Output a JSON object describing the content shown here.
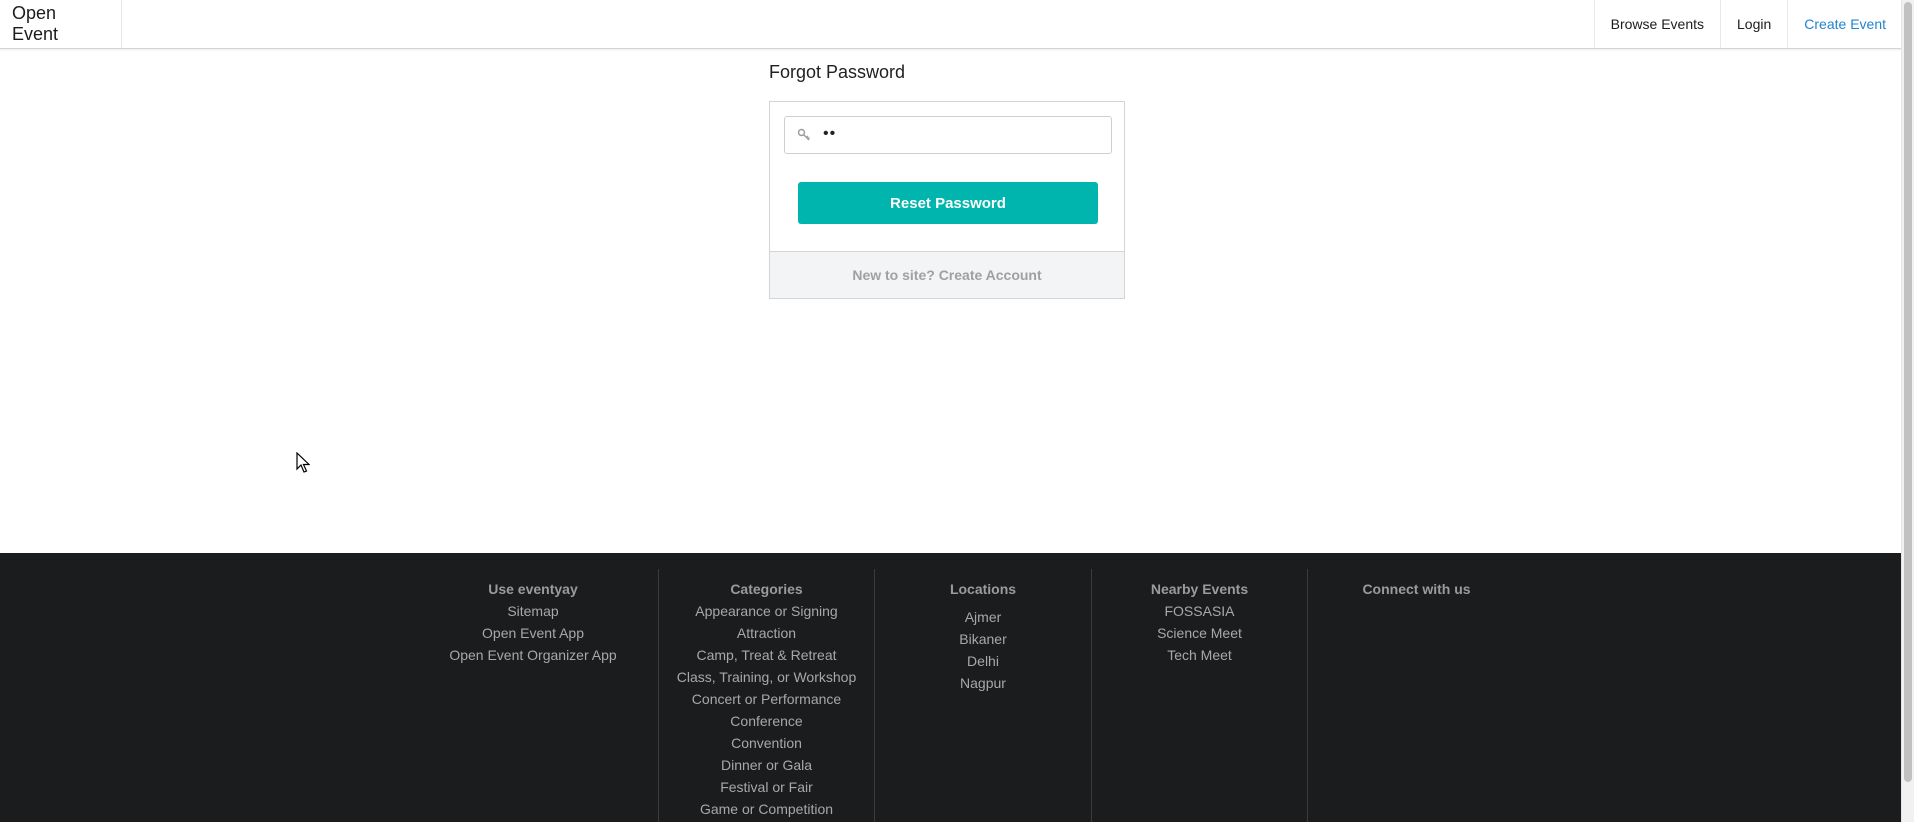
{
  "nav": {
    "brand": "Open Event",
    "items": [
      {
        "label": "Browse Events"
      },
      {
        "label": "Login"
      },
      {
        "label": "Create Event"
      }
    ],
    "accent_color": "#2185d0"
  },
  "forgot": {
    "title": "Forgot Password",
    "input_value": "••",
    "input_icon": "key-icon",
    "button_label": "Reset Password",
    "button_color": "#00b5ad",
    "footer_link": "New to site? Create Account"
  },
  "footer": {
    "background": "#1b1c1d",
    "columns": [
      {
        "heading": "Use eventyay",
        "links": [
          "Sitemap",
          "Open Event App",
          "Open Event Organizer App"
        ]
      },
      {
        "heading": "Categories",
        "links": [
          "Appearance or Signing",
          "Attraction",
          "Camp, Treat & Retreat",
          "Class, Training, or Workshop",
          "Concert or Performance",
          "Conference",
          "Convention",
          "Dinner or Gala",
          "Festival or Fair",
          "Game or Competition"
        ]
      },
      {
        "heading": "Locations",
        "links": [
          "Ajmer",
          "Bikaner",
          "Delhi",
          "Nagpur"
        ]
      },
      {
        "heading": "Nearby Events",
        "links": [
          "FOSSASIA",
          "Science Meet",
          "Tech Meet"
        ]
      },
      {
        "heading": "Connect with us",
        "links": []
      }
    ]
  }
}
